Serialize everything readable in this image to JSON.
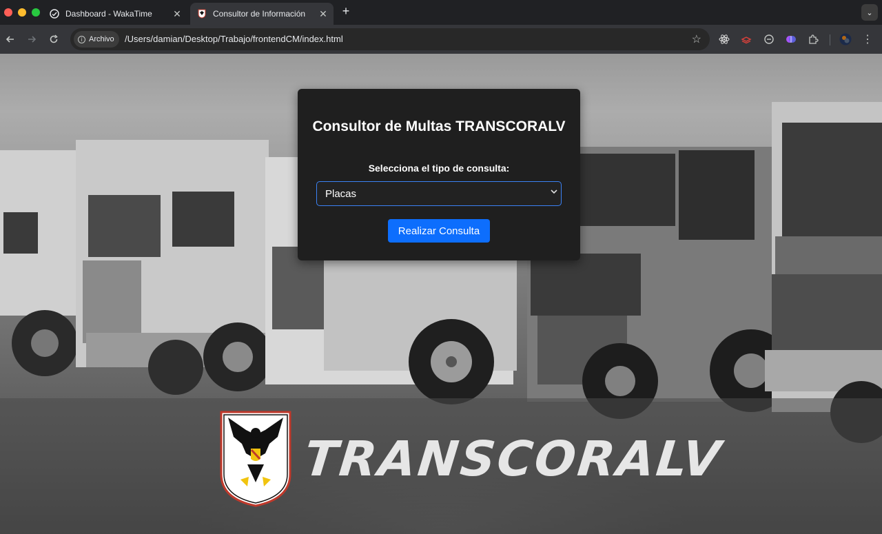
{
  "browser": {
    "tabs": [
      {
        "title": "Dashboard - WakaTime",
        "active": false,
        "icon": "wakatime-icon"
      },
      {
        "title": "Consultor de Información",
        "active": true,
        "icon": "transcoralv-favicon"
      }
    ],
    "address": {
      "chip_label": "Archivo",
      "url": "/Users/damian/Desktop/Trabajo/frontendCM/index.html"
    }
  },
  "page": {
    "background": "black-and-white photo of parked trucks",
    "card": {
      "title": "Consultor de Multas TRANSCORALV",
      "select_label": "Selecciona el tipo de consulta:",
      "select_value": "Placas",
      "submit_label": "Realizar Consulta"
    },
    "brand_text": "TRANSCORALV"
  },
  "colors": {
    "accent": "#0d6efd",
    "card_bg": "#1f1f1f",
    "select_border": "#3b82f6"
  }
}
